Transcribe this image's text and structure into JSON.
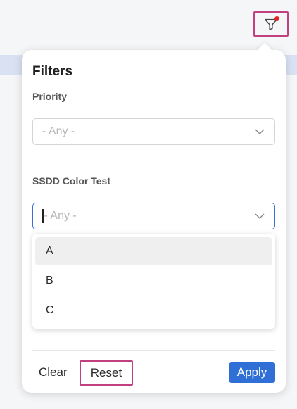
{
  "panel": {
    "title": "Filters",
    "priority": {
      "label": "Priority",
      "value": "- Any -"
    },
    "color_test": {
      "label": "SSDD Color Test",
      "value": "- Any -",
      "options": [
        "A",
        "B",
        "C"
      ]
    },
    "actions": {
      "clear": "Clear",
      "reset": "Reset",
      "apply": "Apply"
    }
  },
  "icons": {
    "filter": "funnel-icon",
    "chevron": "chevron-down-icon"
  },
  "colors": {
    "accent": "#2f6fd6",
    "highlight_outline": "#c2407f",
    "notification_dot": "#e02424"
  }
}
